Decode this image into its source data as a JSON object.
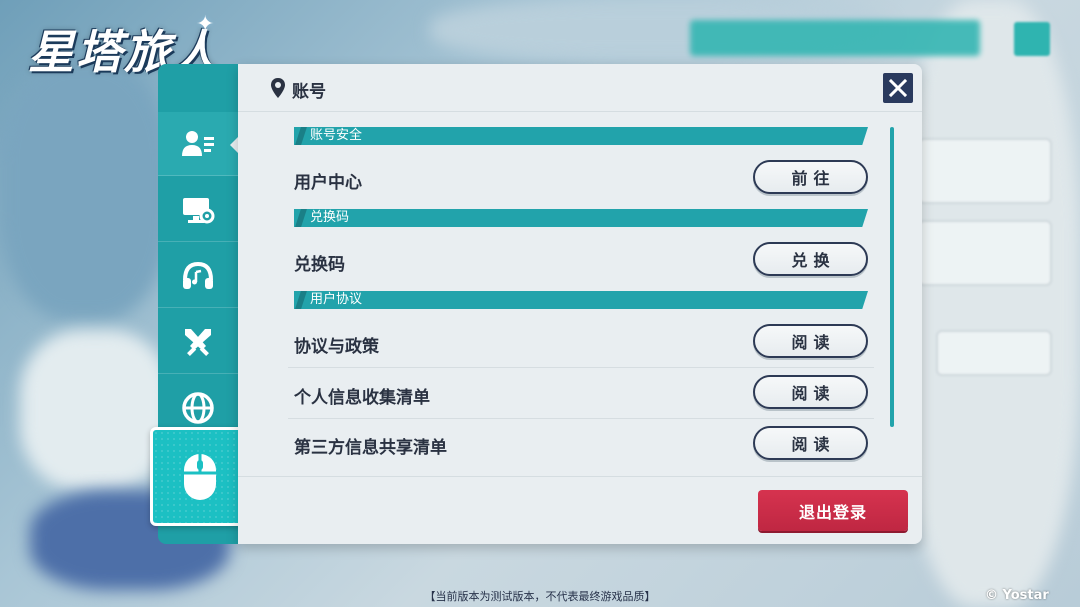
{
  "game": {
    "logo_text": "星塔旅人"
  },
  "panel": {
    "title": "账号",
    "sections": [
      {
        "label": "账号安全",
        "rows": [
          {
            "label": "用户中心",
            "button": "前往"
          }
        ]
      },
      {
        "label": "兑换码",
        "rows": [
          {
            "label": "兑换码",
            "button": "兑换"
          }
        ]
      },
      {
        "label": "用户协议",
        "rows": [
          {
            "label": "协议与政策",
            "button": "阅读"
          },
          {
            "label": "个人信息收集清单",
            "button": "阅读"
          },
          {
            "label": "第三方信息共享清单",
            "button": "阅读"
          }
        ]
      }
    ],
    "logout_label": "退出登录"
  },
  "sidebar": {
    "items": [
      {
        "icon": "account-icon"
      },
      {
        "icon": "display-settings-icon"
      },
      {
        "icon": "headphones-icon"
      },
      {
        "icon": "crossed-swords-icon"
      },
      {
        "icon": "globe-icon"
      },
      {
        "icon": "mouse-icon",
        "selected": true
      }
    ]
  },
  "footer": {
    "notice": "【当前版本为测试版本，不代表最终游戏品质】",
    "copyright": "© Yostar"
  },
  "colors": {
    "accent": "#22a3ab",
    "danger": "#d6334f",
    "navy": "#2a3a5e",
    "panel": "#e9eef1"
  }
}
